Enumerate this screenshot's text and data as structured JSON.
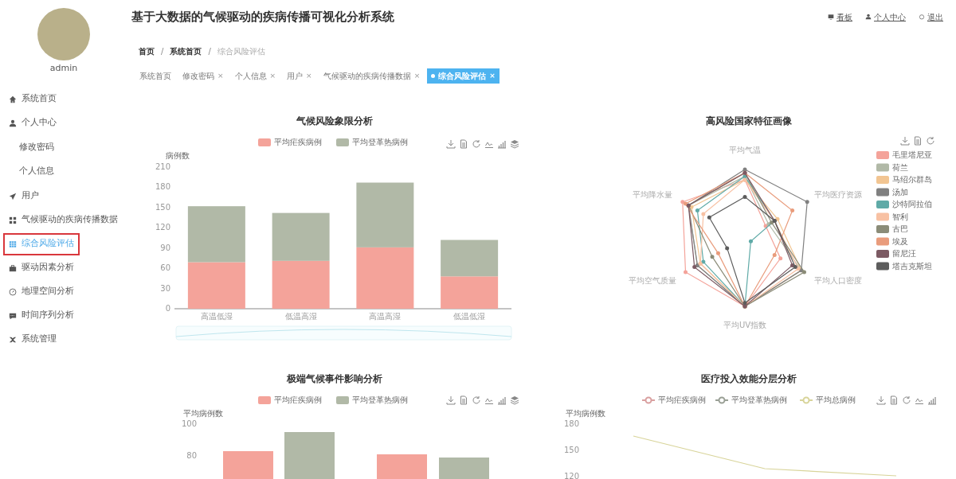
{
  "sidebar": {
    "user": "admin",
    "items": [
      {
        "label": "系统首页",
        "selected": false,
        "outlined": false
      },
      {
        "label": "个人中心",
        "selected": false,
        "outlined": false,
        "children": [
          {
            "label": "修改密码",
            "selected": false
          },
          {
            "label": "个人信息",
            "selected": false
          }
        ]
      },
      {
        "label": "用户",
        "selected": false,
        "outlined": false
      },
      {
        "label": "气候驱动的疾病传播数据",
        "selected": false,
        "outlined": false
      },
      {
        "label": "综合风险评估",
        "selected": true,
        "outlined": true
      },
      {
        "label": "驱动因素分析",
        "selected": false,
        "outlined": false
      },
      {
        "label": "地理空间分析",
        "selected": false,
        "outlined": false
      },
      {
        "label": "时间序列分析",
        "selected": false,
        "outlined": false
      },
      {
        "label": "系统管理",
        "selected": false,
        "outlined": false
      }
    ]
  },
  "header": {
    "title": "基于大数据的气候驱动的疾病传播可视化分析系统",
    "links": [
      "看板",
      "个人中心",
      "退出"
    ]
  },
  "breadcrumb": {
    "separator": "/",
    "items": [
      {
        "label": "首页",
        "current": false
      },
      {
        "label": "系统首页",
        "current": false
      },
      {
        "label": "综合风险评估",
        "current": true
      }
    ]
  },
  "tags": [
    {
      "label": "系统首页",
      "selected": false
    },
    {
      "label": "修改密码",
      "selected": false,
      "close": "×"
    },
    {
      "label": "个人信息",
      "selected": false,
      "close": "×"
    },
    {
      "label": "用户",
      "selected": false,
      "close": "×"
    },
    {
      "label": "气候驱动的疾病传播数据",
      "selected": false,
      "close": "×"
    },
    {
      "label": "综合风险评估",
      "selected": true,
      "close": "×"
    }
  ],
  "panels": [
    {
      "title": "气候风险象限分析",
      "chart_data": {
        "type": "bar",
        "legend": "top",
        "ylabel": "病例数",
        "categories": [
          "高温低湿",
          "低温高湿",
          "高温高湿",
          "低温低湿"
        ],
        "stacked": true,
        "ylim": [
          0,
          210
        ],
        "yticks": [
          0,
          30,
          60,
          90,
          120,
          150,
          180,
          210
        ],
        "series": [
          {
            "name": "平均疟疾病例",
            "color": "#f4a39a",
            "values": [
              69,
              71,
              91,
              48
            ]
          },
          {
            "name": "平均登革热病例",
            "color": "#b1b9a7",
            "values": [
              83,
              71,
              96,
              54
            ]
          }
        ]
      }
    },
    {
      "title": "高风险国家特征画像",
      "radar": {
        "axes": [
          "平均气温",
          "平均降水量",
          "平均医疗资源",
          "平均空气质量",
          "平均人口密度",
          "平均UV指数"
        ],
        "legend": [
          {
            "name": "毛里塔尼亚",
            "color": "#f4a39a"
          },
          {
            "name": "荷兰",
            "color": "#b1b9a7"
          },
          {
            "name": "马绍尔群岛",
            "color": "#f2c592"
          },
          {
            "name": "汤加",
            "color": "#808080"
          },
          {
            "name": "沙特阿拉伯",
            "color": "#5faaa7"
          },
          {
            "name": "智利",
            "color": "#f8c1a3"
          },
          {
            "name": "古巴",
            "color": "#8b8c78"
          },
          {
            "name": "埃及",
            "color": "#e99c7c"
          },
          {
            "name": "留尼汪",
            "color": "#7c5a63"
          },
          {
            "name": "塔吉克斯坦",
            "color": "#5d5d5d"
          }
        ]
      }
    },
    {
      "title": "极端气候事件影响分析",
      "ylabel": "平均病例数",
      "ytick_labels": [
        "100",
        "80"
      ],
      "legend": [
        {
          "name": "平均疟疾病例",
          "color": "#f4a39a"
        },
        {
          "name": "平均登革热病例",
          "color": "#b1b9a7"
        }
      ]
    },
    {
      "title": "医疗投入效能分层分析",
      "ylabel": "平均病例数",
      "ytick_labels": [
        "180",
        "150",
        "120"
      ],
      "legend": [
        {
          "name": "平均疟疾病例",
          "color": "#d9a0a0"
        },
        {
          "name": "平均登革热病例",
          "color": "#9aa096"
        },
        {
          "name": "平均总病例",
          "color": "#d8d49a"
        }
      ]
    }
  ]
}
